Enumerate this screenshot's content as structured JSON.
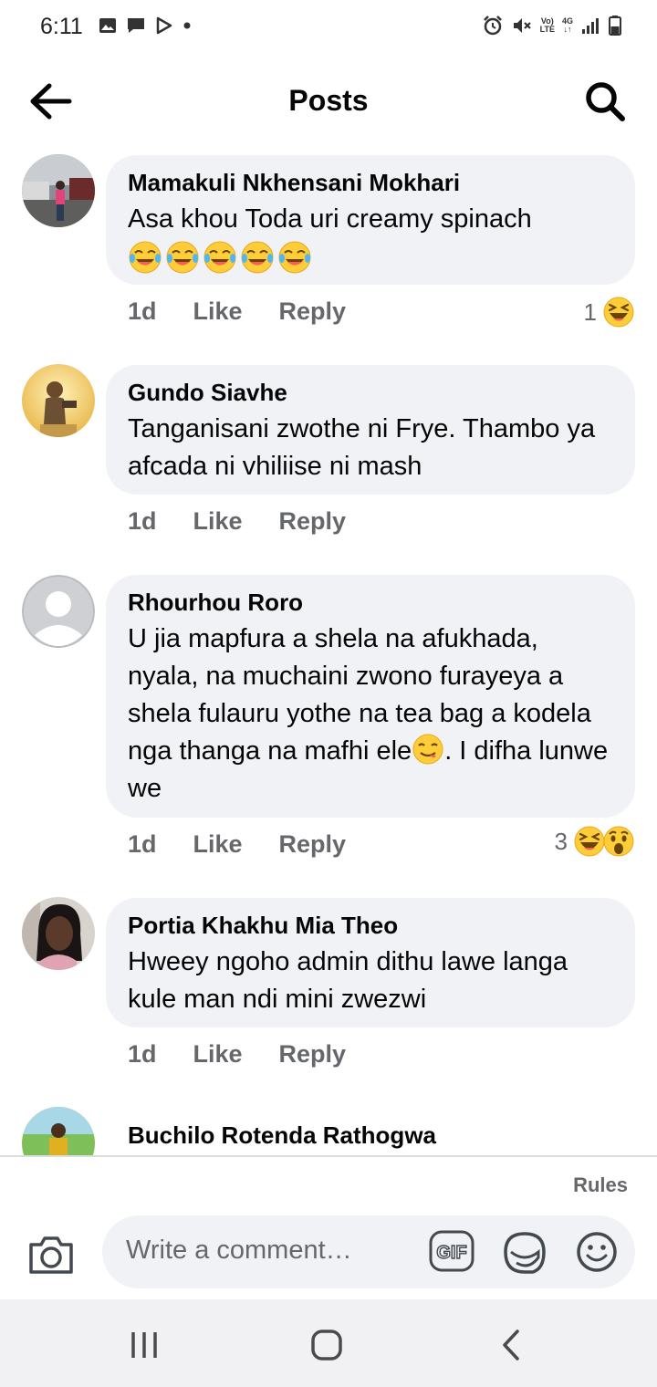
{
  "status_bar": {
    "time": "6:11",
    "volte_top": "Vo)",
    "volte_bottom": "LTE",
    "network_top": "4G",
    "network_bottom": "↓↑"
  },
  "header": {
    "title": "Posts"
  },
  "comments": [
    {
      "author": "Mamakuli Nkhensani Mokhari",
      "text": "Asa khou Toda uri creamy spinach",
      "text_emojis": [
        "tears-of-joy-emoji",
        "tears-of-joy-emoji",
        "tears-of-joy-emoji",
        "tears-of-joy-emoji",
        "tears-of-joy-emoji"
      ],
      "time": "1d",
      "like": "Like",
      "reply": "Reply",
      "reaction_count": "1",
      "reactions": [
        "haha-reaction"
      ]
    },
    {
      "author": "Gundo Siavhe",
      "text": "Tanganisani zwothe ni Frye. Thambo ya afcada ni vhiliise ni mash",
      "time": "1d",
      "like": "Like",
      "reply": "Reply"
    },
    {
      "author": "Rhourhou Roro",
      "text_part1": "U jia mapfura a shela na afukhada, nyala, na muchaini zwono furayeya a shela fulauru yothe na tea bag a kodela nga thanga na mafhi ele",
      "text_part2": ". I difha lunwe we",
      "inline_emoji": "yum-emoji",
      "time": "1d",
      "like": "Like",
      "reply": "Reply",
      "reaction_count": "3",
      "reactions": [
        "haha-reaction",
        "wow-reaction"
      ]
    },
    {
      "author": "Portia Khakhu Mia Theo",
      "text": "Hweey ngoho admin dithu lawe langa kule man ndi mini zwezwi",
      "time": "1d",
      "like": "Like",
      "reply": "Reply"
    },
    {
      "author": "Buchilo Rotenda Rathogwa"
    }
  ],
  "composer": {
    "rules": "Rules",
    "placeholder": "Write a comment…",
    "gif_label": "GIF"
  },
  "colors": {
    "bubble": "#f0f2f5",
    "secondary_text": "#65676b",
    "reaction_yellow": "#ffcc3a"
  }
}
